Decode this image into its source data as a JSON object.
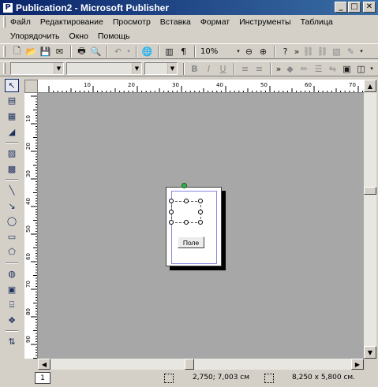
{
  "title": "Publication2 - Microsoft Publisher",
  "menu": [
    "Файл",
    "Редактирование",
    "Просмотр",
    "Вставка",
    "Формат",
    "Инструменты",
    "Таблица"
  ],
  "menu2": [
    "Упорядочить",
    "Окно",
    "Помощь"
  ],
  "zoom": "10%",
  "hruler_labels": [
    "10",
    "20",
    "30",
    "40",
    "50",
    "60",
    "70"
  ],
  "vruler_labels": [
    "10",
    "20",
    "30",
    "40",
    "50",
    "60",
    "70",
    "80",
    "90"
  ],
  "field_button": "Поле",
  "page_tab": "1",
  "status_position": "2,750; 7,003 см",
  "status_size": "8,250 x 5,800 см."
}
